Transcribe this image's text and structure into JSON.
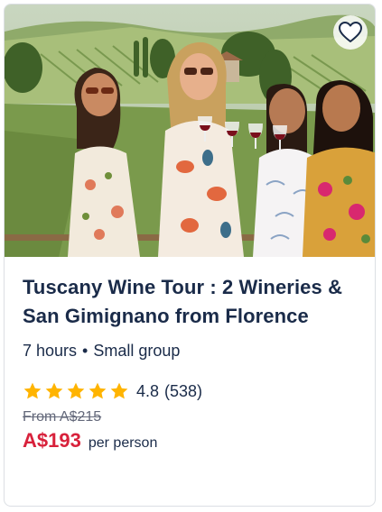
{
  "card": {
    "image_alt": "Four women toasting with red wine in Tuscan vineyard",
    "wishlist_icon": "heart-outline-icon",
    "title": "Tuscany Wine Tour : 2 Wineries & San Gimignano from Florence",
    "duration": "7 hours",
    "separator": "•",
    "group": "Small group",
    "rating": {
      "value": "4.8",
      "stars": 5,
      "reviews": "(538)",
      "star_color": "#ffb400"
    },
    "from_label": "From A$215",
    "price": "A$193",
    "per": "per person",
    "colors": {
      "title": "#1a2b49",
      "price": "#d8213b",
      "strike": "#63687a",
      "border": "#dcdfe4"
    }
  }
}
